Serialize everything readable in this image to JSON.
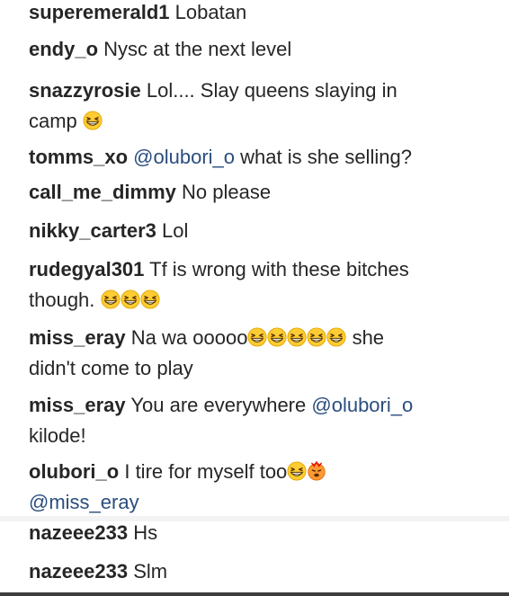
{
  "comments": [
    {
      "user": "superemerald1",
      "text": "Lobatan"
    },
    {
      "user": "endy_o",
      "text": "Nysc at the next level"
    },
    {
      "user": "snazzyrosie",
      "text_line1": "Lol.... Slay queens slaying in",
      "text_line2": "camp"
    },
    {
      "user": "tomms_xo",
      "mention": "@olubori_o",
      "text": "what is she selling?"
    },
    {
      "user": "call_me_dimmy",
      "text": "No please"
    },
    {
      "user": "nikky_carter3",
      "text": "Lol"
    },
    {
      "user": "rudegyal301",
      "text_line1": "Tf is wrong with these bitches",
      "text_line2": "though."
    },
    {
      "user": "miss_eray",
      "text_a": "Na wa ooooo",
      "text_b": "she",
      "text_line2": "didn't come to play"
    },
    {
      "user": "miss_eray",
      "text": "You are everywhere",
      "mention": "@olubori_o",
      "text_line2": "kilode!"
    },
    {
      "user": "olubori_o",
      "text": "I tire for myself too",
      "mention": "@miss_eray"
    },
    {
      "user": "nazeee233",
      "text": "Hs"
    },
    {
      "user": "nazeee233",
      "text": "Slm"
    }
  ],
  "emoji_icon": "grinning-squinting-face-icon",
  "pouting_emoji_icon": "hot-face-icon"
}
